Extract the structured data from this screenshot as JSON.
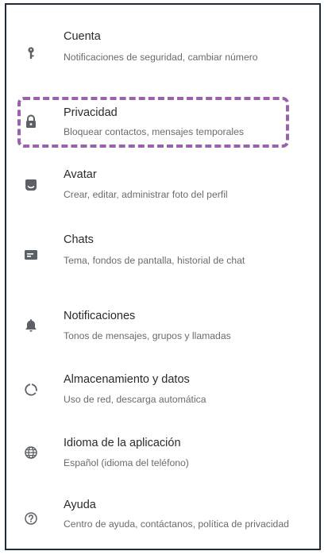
{
  "colors": {
    "highlight": "#9a62a8",
    "icon": "#5b5f66",
    "title": "#2a2a2a",
    "subtitle": "#6b6b6b",
    "frame_border": "#1f2b3a"
  },
  "settings": {
    "items": [
      {
        "icon": "key-icon",
        "title": "Cuenta",
        "subtitle": "Notificaciones de seguridad, cambiar número"
      },
      {
        "icon": "lock-icon",
        "title": "Privacidad",
        "subtitle": "Bloquear contactos, mensajes temporales"
      },
      {
        "icon": "avatar-icon",
        "title": "Avatar",
        "subtitle": "Crear, editar, administrar foto del perfil"
      },
      {
        "icon": "chat-icon",
        "title": "Chats",
        "subtitle": "Tema, fondos de pantalla, historial de chat"
      },
      {
        "icon": "bell-icon",
        "title": "Notificaciones",
        "subtitle": "Tonos de mensajes, grupos y llamadas"
      },
      {
        "icon": "data-usage-icon",
        "title": "Almacenamiento y datos",
        "subtitle": "Uso de red, descarga automática"
      },
      {
        "icon": "globe-icon",
        "title": "Idioma de la aplicación",
        "subtitle": "Español (idioma del teléfono)"
      },
      {
        "icon": "help-icon",
        "title": "Ayuda",
        "subtitle": "Centro de ayuda, contáctanos, política de privacidad"
      }
    ]
  }
}
